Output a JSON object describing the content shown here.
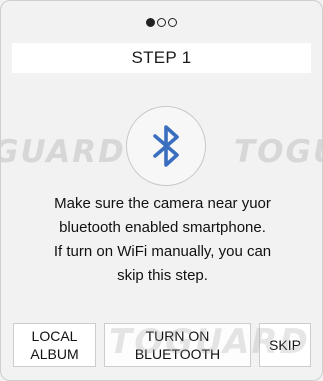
{
  "pager": {
    "total": 3,
    "active_index": 0
  },
  "step_title": "STEP 1",
  "watermark": {
    "left": "GUARD",
    "right": "TOGUA",
    "bottom": "TOGUARD"
  },
  "icon": {
    "name": "bluetooth-icon",
    "color": "#3a6fc0"
  },
  "message": {
    "line1": "Make sure the camera near yuor",
    "line2": "bluetooth enabled smartphone.",
    "line3": "If turn on WiFi manually, you can",
    "line4": "skip this step."
  },
  "buttons": {
    "local_album": "LOCAL\nALBUM",
    "turn_on_bluetooth": "TURN ON\nBLUETOOTH",
    "skip": "SKIP"
  }
}
